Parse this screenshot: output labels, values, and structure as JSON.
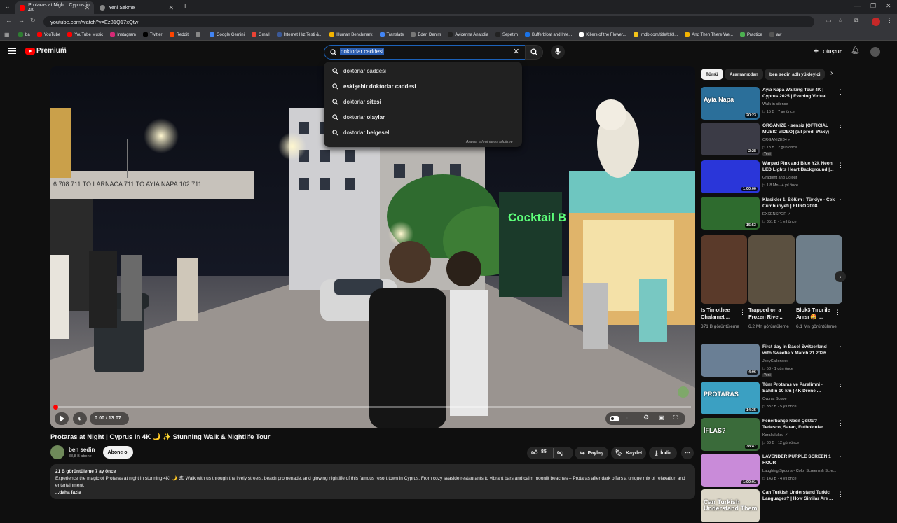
{
  "browser": {
    "tabs": [
      {
        "title": "Protaras at Night | Cyprus in 4K"
      },
      {
        "title": "Yeni Sekme"
      }
    ],
    "url": "youtube.com/watch?v=Ez81Q17xQtw",
    "bookmarks": [
      "ba",
      "YouTube",
      "YouTube Music",
      "Instagram",
      "Twitter",
      "Reddit",
      "",
      "Google Gemini",
      "Gmail",
      "İnternet Hız Testi &...",
      "Human Benchmark",
      "Translate",
      "Eden Denim",
      "Avicenna Anatolia",
      "Sepetim",
      "Bufferbloat and Inte...",
      "Killers of the Flower...",
      "imdb.com/title/tt63...",
      "And Then There We...",
      "Practice",
      "aw"
    ],
    "bookmark_colors": [
      "#2e7d32",
      "#ff0000",
      "#ff0000",
      "#d62976",
      "#000000",
      "#ff4500",
      "#888888",
      "#4285f4",
      "#ea4335",
      "#3b5998",
      "#f4b400",
      "#4285f4",
      "#777777",
      "#222222",
      "#222222",
      "#1a73e8",
      "#ffffff",
      "#f5c518",
      "#f4b400",
      "#4caf50",
      "#555555"
    ]
  },
  "header": {
    "logo": "Premium",
    "logo_sup": "TR",
    "search_value": "doktorlar caddesi",
    "create_label": "Oluştur"
  },
  "suggestions": [
    {
      "text": "doktorlar caddesi",
      "bold": ""
    },
    {
      "text": "eskişehir doktorlar caddesi",
      "bold": ""
    },
    {
      "text": "doktorlar ",
      "bold": "sitesi"
    },
    {
      "text": "doktorlar ",
      "bold": "olaylar"
    },
    {
      "text": "doktorlar ",
      "bold": "belgesel"
    }
  ],
  "suggestions_footer": "Arama tahminlerini bildirme",
  "video": {
    "scene_text": {
      "sign": "6 708 711 TO LARNACA 711 TO AYIA NAPA 102 711",
      "cocktail": "Cocktail B"
    },
    "time": "0:00 / 13:07",
    "progress": 0,
    "title": "Protaras at Night | Cyprus in 4K 🌙 ✨ Stunning Walk & Nightlife Tour",
    "channel": "ben sedin",
    "subs": "38,8 B abone",
    "subscribe": "Abone ol",
    "likes": "85",
    "share": "Paylaş",
    "save": "Kaydet",
    "download": "İndir",
    "views_date": "21 B görüntüleme  7 ay önce",
    "description": "Experience the magic of Protaras at night in stunning 4K! 🌙 🏖 Walk with us through the lively streets, beach promenade, and glowing nightlife of this famous resort town in Cyprus. From cozy seaside restaurants to vibrant bars and calm moonlit beaches – Protaras after dark offers a unique mix of relaxation and entertainment.",
    "more": "...daha fazla"
  },
  "chips": [
    "Tümü",
    "Aramanızdan",
    "ben sedin adlı yükleyici"
  ],
  "recs_top": [
    {
      "title": "Ayia Napa Walking Tour 4K | Cyprus 2025 | Evening Virtual ...",
      "channel": "Walk in silence",
      "meta": "▷ 15 B · 7 ay önce",
      "dur": "20:23",
      "color": "#2b6f9a",
      "badge": "",
      "thumb_text": "Ayia Napa"
    },
    {
      "title": "ORGANIZE - sensiz [OFFICIAL MUSIC VIDEO] (all prod. Waxy)",
      "channel": "ORGANIZE34 ✓",
      "meta": "▷ 73 B · 2 gün önce",
      "dur": "2:28",
      "color": "#3b3b46",
      "badge": "Yeni",
      "thumb_text": ""
    },
    {
      "title": "Warped Pink and Blue Y2k Neon LED Lights Heart Background |...",
      "channel": "Gradient and Colour",
      "meta": "▷ 1,8 Mn · 4 yıl önce",
      "dur": "1:00:00",
      "color": "#2a36d9",
      "badge": "",
      "thumb_text": ""
    },
    {
      "title": "Klasikler 1. Bölüm : Türkiye - Çek Cumhuriyeti | EURO 2008 ...",
      "channel": "EXXENSPOR ✓",
      "meta": "▷ 851 B · 1 yıl önce",
      "dur": "15:53",
      "color": "#2e6b2e",
      "badge": "",
      "thumb_text": ""
    }
  ],
  "shorts": [
    {
      "title": "Is Timothee Chalamet ...",
      "meta": "371 B görüntüleme",
      "color": "#5a3a2a"
    },
    {
      "title": "Trapped on a Frozen Rive...",
      "meta": "6,2 Mn görüntüleme",
      "color": "#5b5040"
    },
    {
      "title": "Blok3 Tırcı ile Anısı 🤩 ...",
      "meta": "6,1 Mn görüntüleme",
      "color": "#6e7e8a"
    }
  ],
  "recs_bottom": [
    {
      "title": "First day in Basel Switzerland with Sweetie x March 21 2026",
      "channel": "JoeyGallonxxx",
      "meta": "▷ 58 · 1 gün önce",
      "dur": "4:06",
      "color": "#6a7f95",
      "badge": "Yeni",
      "thumb_text": ""
    },
    {
      "title": "Tüm Protaras ve Paralimni - Sahilin 10 km | 4K Drone ...",
      "channel": "Cyprus Scope",
      "meta": "▷ 332 B · 5 yıl önce",
      "dur": "14:35",
      "color": "#3ba0c2",
      "badge": "",
      "thumb_text": "PROTARAS"
    },
    {
      "title": "Fenerbahçe Nasıl Çöktü? Tedesco, Saran, Futbolcular...",
      "channel": "Karakulukcu ✓",
      "meta": "▷ 60 B · 12 gün önce",
      "dur": "38:47",
      "color": "#3a6b3a",
      "badge": "",
      "thumb_text": "İFLAS?"
    },
    {
      "title": "LAVENDER PURPLE SCREEN 1 HOUR",
      "channel": "Laughing Spoons - Color Screens & Scre...",
      "meta": "▷ 143 B · 4 yıl önce",
      "dur": "1:00:01",
      "color": "#c98bd9",
      "badge": "",
      "thumb_text": ""
    },
    {
      "title": "Can Turkish Understand Turkic Languages? | How Similar Are ...",
      "channel": "",
      "meta": "",
      "dur": "",
      "color": "#dcd7c8",
      "badge": "",
      "thumb_text": "Can Turkish Understand Them"
    }
  ],
  "colors": {
    "accent": "#ff0000",
    "blue": "#3ea6ff",
    "bg": "#0f0f0f"
  }
}
